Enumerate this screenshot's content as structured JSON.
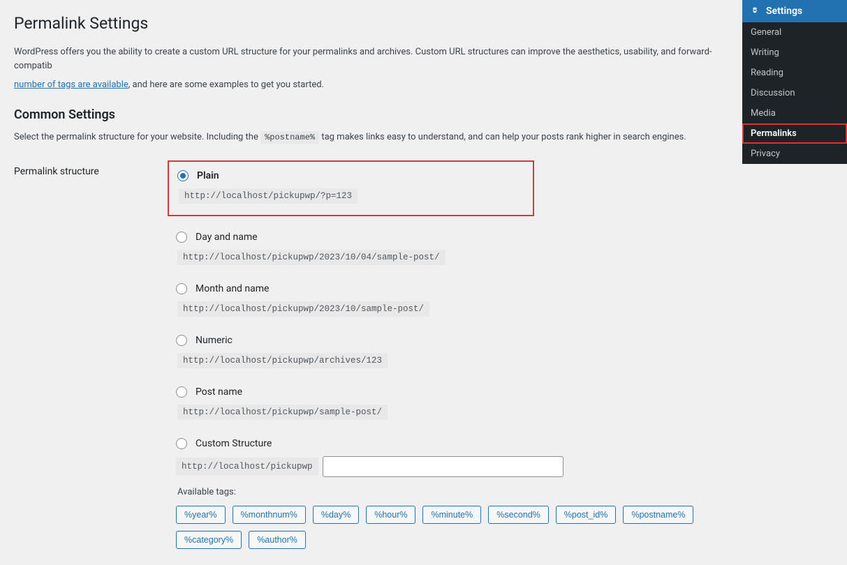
{
  "page": {
    "title": "Permalink Settings",
    "intro_before": "WordPress offers you the ability to create a custom URL structure for your permalinks and archives. Custom URL structures can improve the aesthetics, usability, and forward-compatib",
    "intro_link": "number of tags are available",
    "intro_after": ", and here are some examples to get you started.",
    "common_heading": "Common Settings",
    "common_desc_before": "Select the permalink structure for your website. Including the ",
    "common_tag": "%postname%",
    "common_desc_after": " tag makes links easy to understand, and can help your posts rank higher in search engines.",
    "structure_label": "Permalink structure",
    "options": [
      {
        "label": "Plain",
        "example": "http://localhost/pickupwp/?p=123",
        "checked": true
      },
      {
        "label": "Day and name",
        "example": "http://localhost/pickupwp/2023/10/04/sample-post/",
        "checked": false
      },
      {
        "label": "Month and name",
        "example": "http://localhost/pickupwp/2023/10/sample-post/",
        "checked": false
      },
      {
        "label": "Numeric",
        "example": "http://localhost/pickupwp/archives/123",
        "checked": false
      },
      {
        "label": "Post name",
        "example": "http://localhost/pickupwp/sample-post/",
        "checked": false
      }
    ],
    "custom_label": "Custom Structure",
    "custom_prefix": "http://localhost/pickupwp",
    "custom_value": "",
    "available_label": "Available tags:",
    "tags": [
      "%year%",
      "%monthnum%",
      "%day%",
      "%hour%",
      "%minute%",
      "%second%",
      "%post_id%",
      "%postname%",
      "%category%",
      "%author%"
    ]
  },
  "sidebar": {
    "header": "Settings",
    "items": [
      {
        "label": "General"
      },
      {
        "label": "Writing"
      },
      {
        "label": "Reading"
      },
      {
        "label": "Discussion"
      },
      {
        "label": "Media"
      },
      {
        "label": "Permalinks",
        "active": true
      },
      {
        "label": "Privacy"
      }
    ]
  }
}
